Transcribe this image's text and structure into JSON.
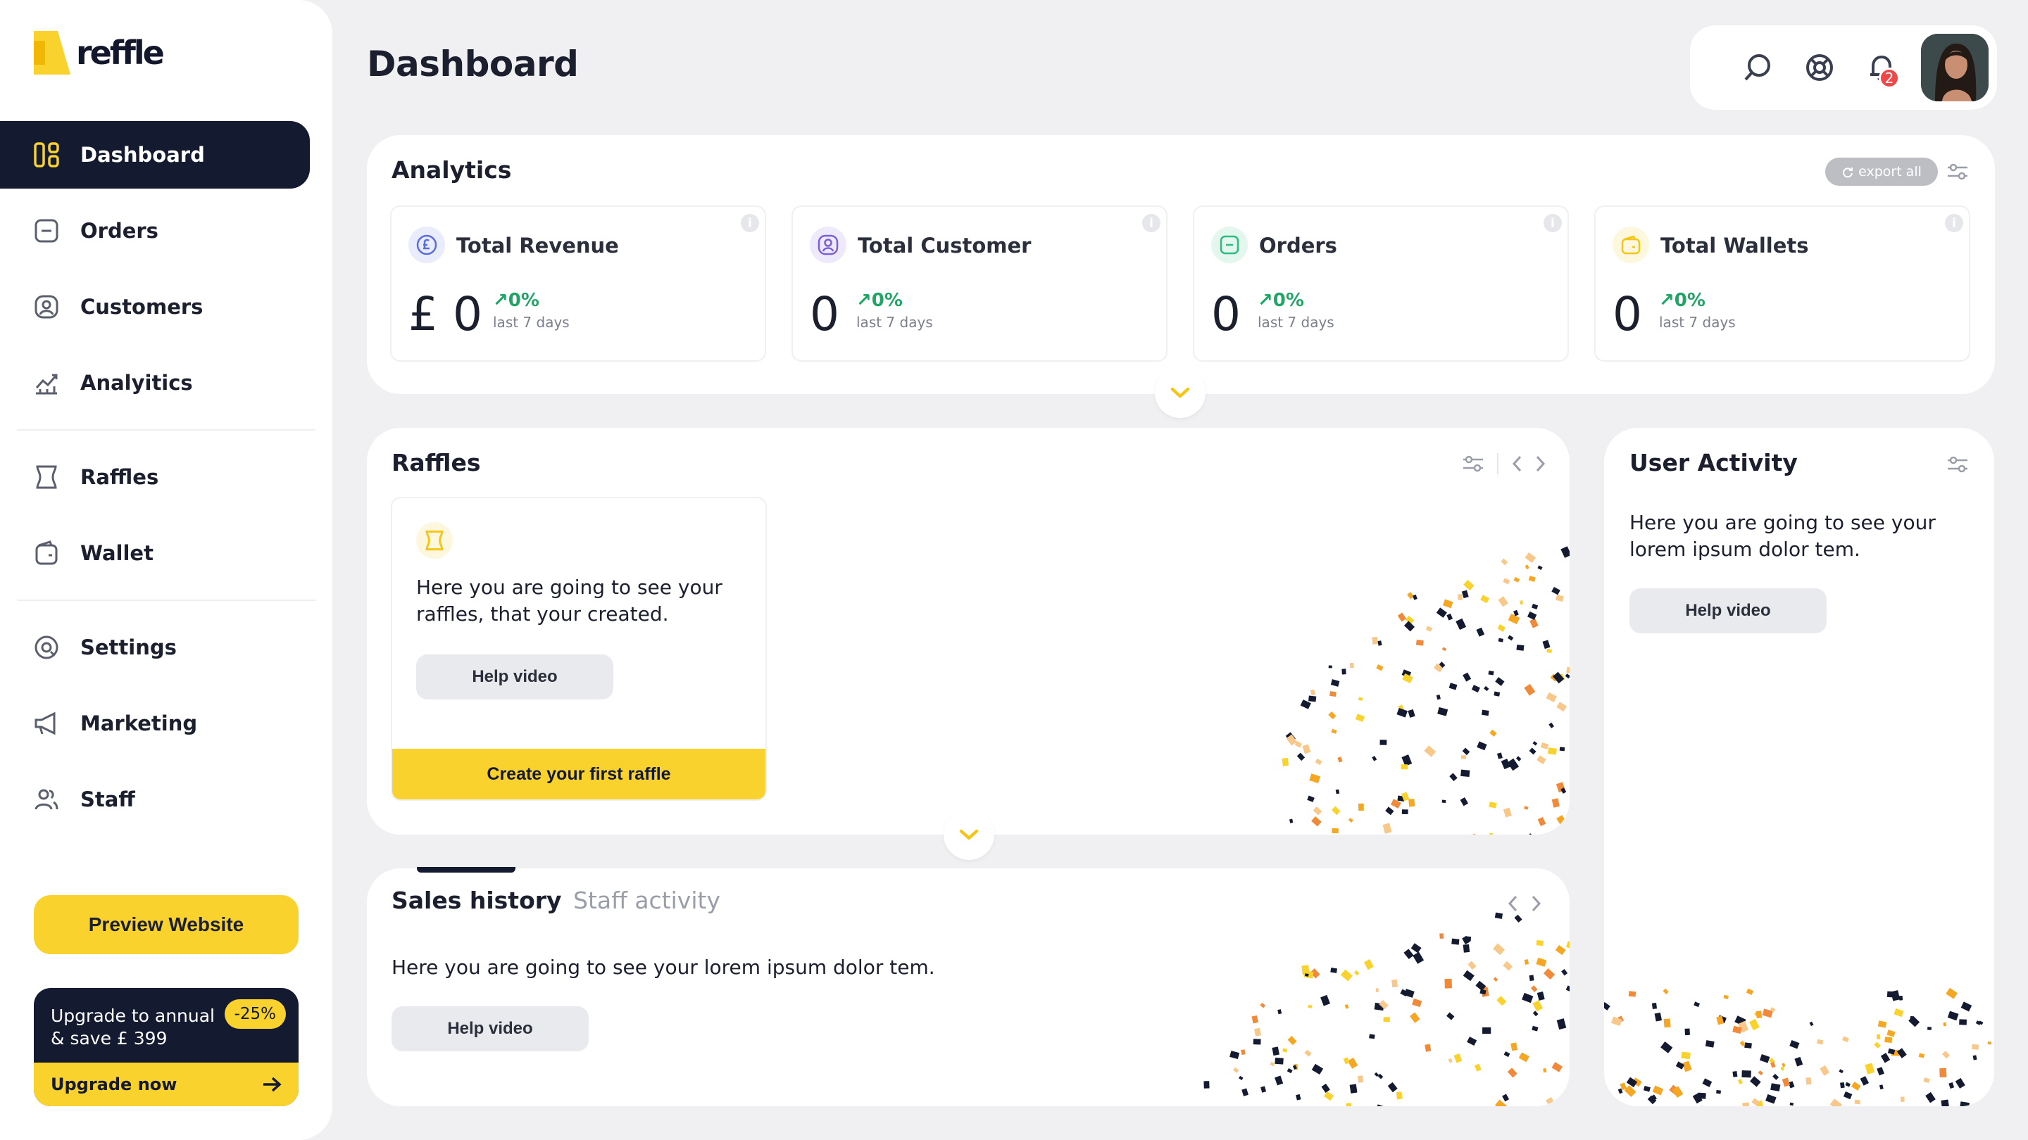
{
  "brand": {
    "name": "reffle",
    "accent": "#fad22e",
    "dark": "#141a30"
  },
  "sidebar": {
    "items": [
      {
        "label": "Dashboard",
        "icon": "dashboard-icon",
        "active": true
      },
      {
        "label": "Orders",
        "icon": "orders-icon"
      },
      {
        "label": "Customers",
        "icon": "customers-icon"
      },
      {
        "label": "Analyitics",
        "icon": "analytics-icon"
      },
      {
        "label": "Raffles",
        "icon": "ticket-icon"
      },
      {
        "label": "Wallet",
        "icon": "wallet-icon"
      },
      {
        "label": "Settings",
        "icon": "settings-icon"
      },
      {
        "label": "Marketing",
        "icon": "megaphone-icon"
      },
      {
        "label": "Staff",
        "icon": "staff-icon"
      }
    ],
    "preview_label": "Preview Website",
    "upgrade": {
      "line1": "Upgrade to annual",
      "line2": "& save £ 399",
      "badge": "-25%",
      "cta": "Upgrade now"
    }
  },
  "header": {
    "title": "Dashboard",
    "icons": [
      "search-icon",
      "support-icon",
      "bell-icon"
    ],
    "notification_count": "2"
  },
  "analytics": {
    "title": "Analytics",
    "export_label": "export all",
    "stats": [
      {
        "name": "Total Revenue",
        "value": "£ 0",
        "change": "0%",
        "period": "last 7 days",
        "icon": "pound-icon",
        "color": "#5b6ee1"
      },
      {
        "name": "Total Customer",
        "value": "0",
        "change": "0%",
        "period": "last 7 days",
        "icon": "customer-icon",
        "color": "#7b5fd6"
      },
      {
        "name": "Orders",
        "value": "0",
        "change": "0%",
        "period": "last 7 days",
        "icon": "orders-icon",
        "color": "#2bbd7e"
      },
      {
        "name": "Total Wallets",
        "value": "0",
        "change": "0%",
        "period": "last 7 days",
        "icon": "wallet-icon",
        "color": "#f5c518"
      }
    ]
  },
  "raffles": {
    "title": "Raffles",
    "text": "Here you are going to see your raffles, that your created.",
    "help_label": "Help video",
    "create_label": "Create your first raffle"
  },
  "user_activity": {
    "title": "User Activity",
    "text": "Here you are going to see your lorem ipsum dolor tem.",
    "help_label": "Help video"
  },
  "sales": {
    "tabs": [
      "Sales history",
      "Staff activity"
    ],
    "text": "Here you are going to see your lorem ipsum dolor tem.",
    "help_label": "Help video"
  }
}
